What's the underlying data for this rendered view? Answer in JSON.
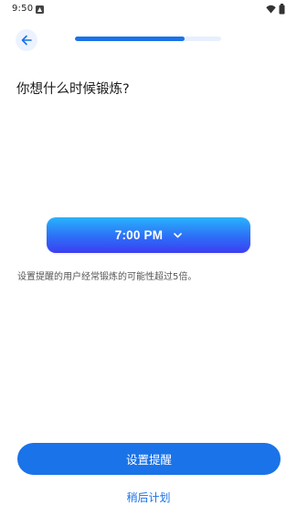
{
  "status_bar": {
    "time": "9:50",
    "icons": [
      "notification-icon",
      "wifi-icon",
      "battery-icon"
    ]
  },
  "header": {
    "back_icon": "arrow-left-icon",
    "progress_percent": 75
  },
  "main": {
    "question": "你想什么时候锻炼?",
    "time_picker": {
      "value": "7:00 PM",
      "icon": "chevron-down-icon"
    },
    "hint": "设置提醒的用户经常锻炼的可能性超过5倍。"
  },
  "footer": {
    "primary_label": "设置提醒",
    "secondary_label": "稍后计划"
  },
  "colors": {
    "accent": "#1a73e8",
    "gradient_top": "#29b3fb",
    "gradient_bottom": "#3c3ef2",
    "progress_track": "#e7f0fd"
  }
}
